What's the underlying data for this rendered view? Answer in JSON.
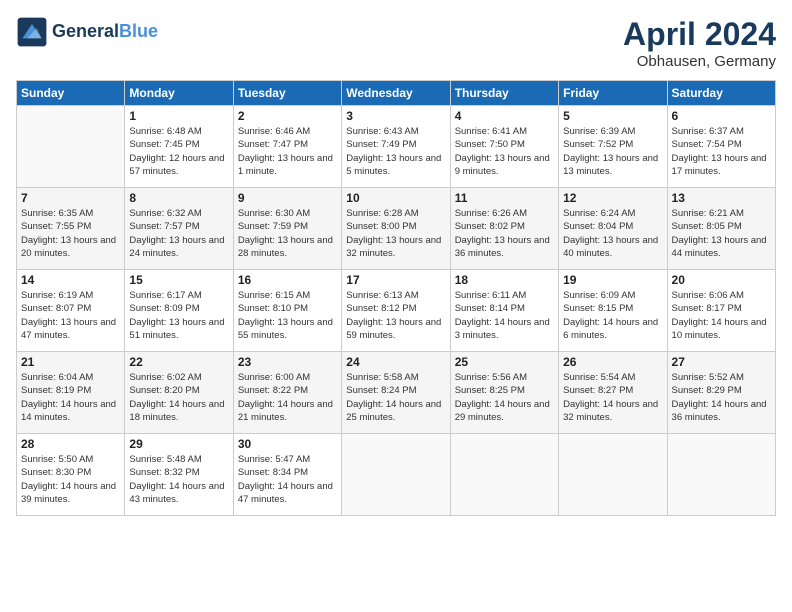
{
  "header": {
    "logo_line1": "General",
    "logo_line2": "Blue",
    "month": "April 2024",
    "location": "Obhausen, Germany"
  },
  "days_of_week": [
    "Sunday",
    "Monday",
    "Tuesday",
    "Wednesday",
    "Thursday",
    "Friday",
    "Saturday"
  ],
  "weeks": [
    [
      {
        "num": "",
        "sunrise": "",
        "sunset": "",
        "daylight": ""
      },
      {
        "num": "1",
        "sunrise": "Sunrise: 6:48 AM",
        "sunset": "Sunset: 7:45 PM",
        "daylight": "Daylight: 12 hours and 57 minutes."
      },
      {
        "num": "2",
        "sunrise": "Sunrise: 6:46 AM",
        "sunset": "Sunset: 7:47 PM",
        "daylight": "Daylight: 13 hours and 1 minute."
      },
      {
        "num": "3",
        "sunrise": "Sunrise: 6:43 AM",
        "sunset": "Sunset: 7:49 PM",
        "daylight": "Daylight: 13 hours and 5 minutes."
      },
      {
        "num": "4",
        "sunrise": "Sunrise: 6:41 AM",
        "sunset": "Sunset: 7:50 PM",
        "daylight": "Daylight: 13 hours and 9 minutes."
      },
      {
        "num": "5",
        "sunrise": "Sunrise: 6:39 AM",
        "sunset": "Sunset: 7:52 PM",
        "daylight": "Daylight: 13 hours and 13 minutes."
      },
      {
        "num": "6",
        "sunrise": "Sunrise: 6:37 AM",
        "sunset": "Sunset: 7:54 PM",
        "daylight": "Daylight: 13 hours and 17 minutes."
      }
    ],
    [
      {
        "num": "7",
        "sunrise": "Sunrise: 6:35 AM",
        "sunset": "Sunset: 7:55 PM",
        "daylight": "Daylight: 13 hours and 20 minutes."
      },
      {
        "num": "8",
        "sunrise": "Sunrise: 6:32 AM",
        "sunset": "Sunset: 7:57 PM",
        "daylight": "Daylight: 13 hours and 24 minutes."
      },
      {
        "num": "9",
        "sunrise": "Sunrise: 6:30 AM",
        "sunset": "Sunset: 7:59 PM",
        "daylight": "Daylight: 13 hours and 28 minutes."
      },
      {
        "num": "10",
        "sunrise": "Sunrise: 6:28 AM",
        "sunset": "Sunset: 8:00 PM",
        "daylight": "Daylight: 13 hours and 32 minutes."
      },
      {
        "num": "11",
        "sunrise": "Sunrise: 6:26 AM",
        "sunset": "Sunset: 8:02 PM",
        "daylight": "Daylight: 13 hours and 36 minutes."
      },
      {
        "num": "12",
        "sunrise": "Sunrise: 6:24 AM",
        "sunset": "Sunset: 8:04 PM",
        "daylight": "Daylight: 13 hours and 40 minutes."
      },
      {
        "num": "13",
        "sunrise": "Sunrise: 6:21 AM",
        "sunset": "Sunset: 8:05 PM",
        "daylight": "Daylight: 13 hours and 44 minutes."
      }
    ],
    [
      {
        "num": "14",
        "sunrise": "Sunrise: 6:19 AM",
        "sunset": "Sunset: 8:07 PM",
        "daylight": "Daylight: 13 hours and 47 minutes."
      },
      {
        "num": "15",
        "sunrise": "Sunrise: 6:17 AM",
        "sunset": "Sunset: 8:09 PM",
        "daylight": "Daylight: 13 hours and 51 minutes."
      },
      {
        "num": "16",
        "sunrise": "Sunrise: 6:15 AM",
        "sunset": "Sunset: 8:10 PM",
        "daylight": "Daylight: 13 hours and 55 minutes."
      },
      {
        "num": "17",
        "sunrise": "Sunrise: 6:13 AM",
        "sunset": "Sunset: 8:12 PM",
        "daylight": "Daylight: 13 hours and 59 minutes."
      },
      {
        "num": "18",
        "sunrise": "Sunrise: 6:11 AM",
        "sunset": "Sunset: 8:14 PM",
        "daylight": "Daylight: 14 hours and 3 minutes."
      },
      {
        "num": "19",
        "sunrise": "Sunrise: 6:09 AM",
        "sunset": "Sunset: 8:15 PM",
        "daylight": "Daylight: 14 hours and 6 minutes."
      },
      {
        "num": "20",
        "sunrise": "Sunrise: 6:06 AM",
        "sunset": "Sunset: 8:17 PM",
        "daylight": "Daylight: 14 hours and 10 minutes."
      }
    ],
    [
      {
        "num": "21",
        "sunrise": "Sunrise: 6:04 AM",
        "sunset": "Sunset: 8:19 PM",
        "daylight": "Daylight: 14 hours and 14 minutes."
      },
      {
        "num": "22",
        "sunrise": "Sunrise: 6:02 AM",
        "sunset": "Sunset: 8:20 PM",
        "daylight": "Daylight: 14 hours and 18 minutes."
      },
      {
        "num": "23",
        "sunrise": "Sunrise: 6:00 AM",
        "sunset": "Sunset: 8:22 PM",
        "daylight": "Daylight: 14 hours and 21 minutes."
      },
      {
        "num": "24",
        "sunrise": "Sunrise: 5:58 AM",
        "sunset": "Sunset: 8:24 PM",
        "daylight": "Daylight: 14 hours and 25 minutes."
      },
      {
        "num": "25",
        "sunrise": "Sunrise: 5:56 AM",
        "sunset": "Sunset: 8:25 PM",
        "daylight": "Daylight: 14 hours and 29 minutes."
      },
      {
        "num": "26",
        "sunrise": "Sunrise: 5:54 AM",
        "sunset": "Sunset: 8:27 PM",
        "daylight": "Daylight: 14 hours and 32 minutes."
      },
      {
        "num": "27",
        "sunrise": "Sunrise: 5:52 AM",
        "sunset": "Sunset: 8:29 PM",
        "daylight": "Daylight: 14 hours and 36 minutes."
      }
    ],
    [
      {
        "num": "28",
        "sunrise": "Sunrise: 5:50 AM",
        "sunset": "Sunset: 8:30 PM",
        "daylight": "Daylight: 14 hours and 39 minutes."
      },
      {
        "num": "29",
        "sunrise": "Sunrise: 5:48 AM",
        "sunset": "Sunset: 8:32 PM",
        "daylight": "Daylight: 14 hours and 43 minutes."
      },
      {
        "num": "30",
        "sunrise": "Sunrise: 5:47 AM",
        "sunset": "Sunset: 8:34 PM",
        "daylight": "Daylight: 14 hours and 47 minutes."
      },
      {
        "num": "",
        "sunrise": "",
        "sunset": "",
        "daylight": ""
      },
      {
        "num": "",
        "sunrise": "",
        "sunset": "",
        "daylight": ""
      },
      {
        "num": "",
        "sunrise": "",
        "sunset": "",
        "daylight": ""
      },
      {
        "num": "",
        "sunrise": "",
        "sunset": "",
        "daylight": ""
      }
    ]
  ]
}
